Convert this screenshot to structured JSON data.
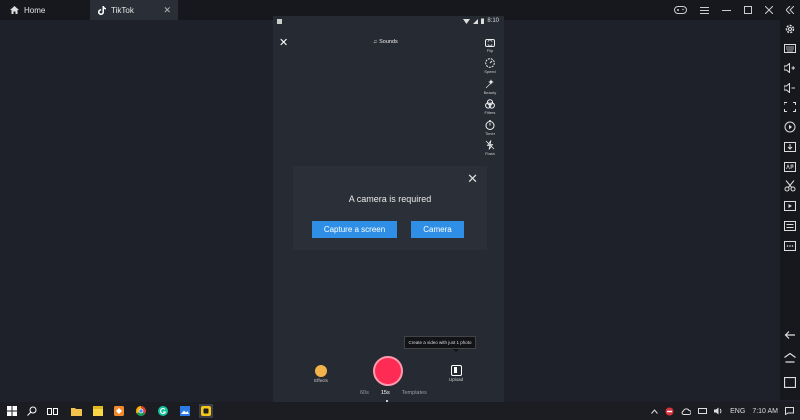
{
  "tabs": [
    {
      "label": "Home"
    },
    {
      "label": "TikTok"
    }
  ],
  "tab_close": "✕",
  "status": {
    "time": "8:10"
  },
  "camera_top": {
    "close": "✕",
    "sounds": "Sounds",
    "sounds_icon": "♫"
  },
  "tools": [
    {
      "label": "Flip",
      "icon": "flip-icon"
    },
    {
      "label": "Speed",
      "icon": "speed-icon"
    },
    {
      "label": "Beauty",
      "icon": "beauty-icon"
    },
    {
      "label": "Filters",
      "icon": "filters-icon"
    },
    {
      "label": "Timer",
      "icon": "timer-icon"
    },
    {
      "label": "Flash",
      "icon": "flash-icon"
    }
  ],
  "dialog": {
    "close": "✕",
    "title": "A camera is required",
    "capture_label": "Capture a screen",
    "camera_label": "Camera",
    "accent": "#2f8fe6"
  },
  "bottom": {
    "tooltip": "Create a video with just 1 photo",
    "effects_label": "Effects",
    "upload_label": "Upload",
    "record_color": "#fe2c55",
    "modes": [
      "60s",
      "15s",
      "Templates"
    ]
  },
  "tray": {
    "language": "ENG",
    "time": "7:10 AM"
  }
}
